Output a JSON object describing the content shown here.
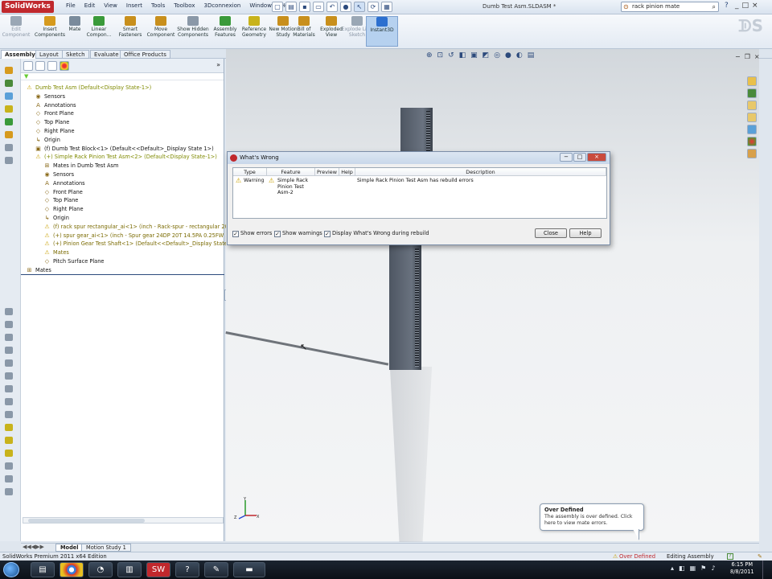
{
  "app": {
    "logo": "SolidWorks",
    "menu": [
      "File",
      "Edit",
      "View",
      "Insert",
      "Tools",
      "Toolbox",
      "3Dconnexion",
      "Window",
      "Help"
    ],
    "document_title": "Dumb Test Asm.SLDASM *",
    "search_value": "rack pinion mate",
    "help": "?",
    "window_controls": [
      "_",
      "□",
      "×"
    ]
  },
  "ribbon": {
    "buttons": [
      {
        "label": "Edit Component",
        "color": "#9aa7b5",
        "dim": true
      },
      {
        "label": "Insert Components",
        "color": "#d69a1d",
        "dim": false
      },
      {
        "label": "Mate",
        "color": "#7a8b9c",
        "dim": false
      },
      {
        "label": "Linear Compon...",
        "color": "#3a9a3a",
        "dim": false
      },
      {
        "label": "Smart Fasteners",
        "color": "#c88f1c",
        "dim": false
      },
      {
        "label": "Move Component",
        "color": "#c88f1c",
        "dim": false
      },
      {
        "label": "Show Hidden Components",
        "color": "#8a98a8",
        "dim": false
      },
      {
        "label": "Assembly Features",
        "color": "#3a9a3a",
        "dim": false
      },
      {
        "label": "Reference Geometry",
        "color": "#c8b31c",
        "dim": false
      },
      {
        "label": "New Motion Study",
        "color": "#c88f1c",
        "dim": false
      },
      {
        "label": "Bill of Materials",
        "color": "#c88f1c",
        "dim": false
      },
      {
        "label": "Exploded View",
        "color": "#c88f1c",
        "dim": false
      },
      {
        "label": "Explode Line Sketch",
        "color": "#9aa7b5",
        "dim": true
      },
      {
        "label": "Instant3D",
        "color": "#2c6fcf",
        "dim": false,
        "active": true
      }
    ]
  },
  "tabs": [
    "Assembly",
    "Layout",
    "Sketch",
    "Evaluate",
    "Office Products"
  ],
  "feature_tree": {
    "rows": [
      {
        "text": "Dumb Test Asm  (Default<Display State-1>)",
        "indent": 0,
        "icon": "⚠",
        "style": "yl"
      },
      {
        "text": "Sensors",
        "indent": 1,
        "icon": "◉",
        "style": ""
      },
      {
        "text": "Annotations",
        "indent": 1,
        "icon": "A",
        "style": ""
      },
      {
        "text": "Front Plane",
        "indent": 1,
        "icon": "◇",
        "style": ""
      },
      {
        "text": "Top Plane",
        "indent": 1,
        "icon": "◇",
        "style": ""
      },
      {
        "text": "Right Plane",
        "indent": 1,
        "icon": "◇",
        "style": ""
      },
      {
        "text": "Origin",
        "indent": 1,
        "icon": "↳",
        "style": ""
      },
      {
        "text": "(f) Dumb Test Block<1> (Default<<Default>_Display State 1>)",
        "indent": 1,
        "icon": "▣",
        "style": ""
      },
      {
        "text": "(+) Simple Rack Pinion Test Asm<2> (Default<Display State-1>)",
        "indent": 1,
        "icon": "⚠",
        "style": "yl"
      },
      {
        "text": "Mates in Dumb Test Asm",
        "indent": 2,
        "icon": "⊞",
        "style": ""
      },
      {
        "text": "Sensors",
        "indent": 2,
        "icon": "◉",
        "style": ""
      },
      {
        "text": "Annotations",
        "indent": 2,
        "icon": "A",
        "style": ""
      },
      {
        "text": "Front Plane",
        "indent": 2,
        "icon": "◇",
        "style": ""
      },
      {
        "text": "Top Plane",
        "indent": 2,
        "icon": "◇",
        "style": ""
      },
      {
        "text": "Right Plane",
        "indent": 2,
        "icon": "◇",
        "style": ""
      },
      {
        "text": "Origin",
        "indent": 2,
        "icon": "↳",
        "style": ""
      },
      {
        "text": "(f) rack spur rectangular_ai<1> (inch - Rack-spur - rectangular 20...",
        "indent": 2,
        "icon": "⚠",
        "style": "warn"
      },
      {
        "text": "(+) spur gear_ai<1> (inch - Spur gear 24DP 20T 14.5PA 0.25FW ...",
        "indent": 2,
        "icon": "⚠",
        "style": "warn"
      },
      {
        "text": "(+) Pinion Gear Test Shaft<1> (Default<<Default>_Display State-1...",
        "indent": 2,
        "icon": "⚠",
        "style": "warn"
      },
      {
        "text": "Mates",
        "indent": 2,
        "icon": "⚠",
        "style": "warn"
      },
      {
        "text": "Pitch Surface Plane",
        "indent": 2,
        "icon": "◇",
        "style": ""
      },
      {
        "text": "Mates",
        "indent": 0,
        "icon": "⊞",
        "style": ""
      }
    ]
  },
  "dialog": {
    "title": "What's Wrong",
    "columns": [
      "Type",
      "Feature",
      "Preview",
      "Help",
      "Description"
    ],
    "row": {
      "type": "Warning",
      "feature": "Simple Rack Pinion Test Asm-2",
      "description": "Simple Rack Pinion Test Asm has rebuild errors"
    },
    "checkboxes": [
      {
        "label": "Show errors",
        "checked": true
      },
      {
        "label": "Show warnings",
        "checked": true
      },
      {
        "label": "Display What's Wrong during rebuild",
        "checked": true
      }
    ],
    "close_label": "Close",
    "help_label": "Help"
  },
  "balloon": {
    "title": "Over Defined",
    "body": "The assembly is over defined. Click here to view mate errors."
  },
  "bottom_tabs": [
    "Model",
    "Motion Study 1"
  ],
  "status": {
    "edition": "SolidWorks Premium 2011 x64 Edition",
    "over_defined": "Over Defined",
    "mode": "Editing Assembly"
  },
  "taskbar": {
    "time": "6:15 PM",
    "date": "8/8/2011",
    "apps": [
      "folder",
      "chrome",
      "gimp",
      "doc",
      "SW",
      "help",
      "pen",
      "cmd"
    ]
  },
  "triad": {
    "y": "Y",
    "x": "X",
    "z": "Z"
  },
  "colors": {
    "brand": "#c0282d",
    "accent": "#2c4a7c"
  }
}
